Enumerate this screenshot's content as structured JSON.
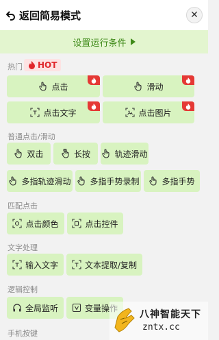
{
  "header": {
    "back_label": "返回简易模式",
    "close_symbol": "✕"
  },
  "run_condition_label": "设置运行条件",
  "hot_section": {
    "title": "热门",
    "tag": "HOT"
  },
  "hot_buttons": [
    "点击",
    "滑动",
    "点击文字",
    "点击图片"
  ],
  "sections": {
    "basic": "普通点击/滑动",
    "match": "匹配点击",
    "text": "文字处理",
    "logic": "逻辑控制",
    "keys": "手机按键"
  },
  "basic_buttons": [
    "双击",
    "长按",
    "轨迹滑动",
    "多指轨迹滑动",
    "多指手势录制",
    "多指手势"
  ],
  "match_buttons": [
    "点击颜色",
    "点击控件"
  ],
  "text_buttons": [
    "输入文字",
    "文本提取/复制"
  ],
  "logic_buttons": [
    "全局监听",
    "变量操作"
  ],
  "watermark": {
    "title": "八神智能天下",
    "url": "zntx.cc"
  },
  "colors": {
    "button_bg": "#d8f3c0",
    "accent_green": "#3f8a19",
    "hot_red": "#e53935"
  }
}
